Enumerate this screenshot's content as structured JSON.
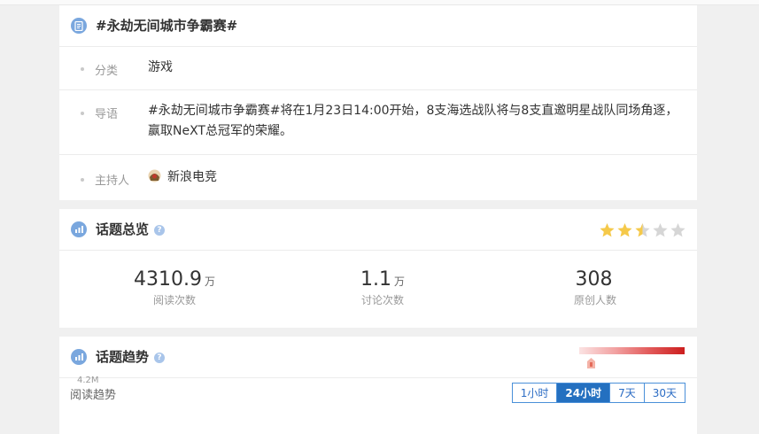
{
  "info": {
    "title": "#永劫无间城市争霸赛#",
    "category_label": "分类",
    "category_value": "游戏",
    "intro_label": "导语",
    "intro_value": "#永劫无间城市争霸赛#将在1月23日14:00开始，8支海选战队将与8支直邀明星战队同场角逐，赢取NeXT总冠军的荣耀。",
    "host_label": "主持人",
    "host_value": "新浪电竞"
  },
  "overview": {
    "title": "话题总览",
    "rating": 2.5,
    "rating_max": 5,
    "stats": [
      {
        "number": "4310.9",
        "unit": "万",
        "caption": "阅读次数"
      },
      {
        "number": "1.1",
        "unit": "万",
        "caption": "讨论次数"
      },
      {
        "number": "308",
        "unit": "",
        "caption": "原创人数"
      }
    ]
  },
  "trend": {
    "title": "话题趋势",
    "sub_label": "阅读趋势",
    "tabs": [
      "1小时",
      "24小时",
      "7天",
      "30天"
    ],
    "active_tab": "24小时",
    "y_top_label": "4.2M",
    "heat_level": 0.1
  },
  "colors": {
    "accent": "#2470c0",
    "star_on": "#f5c94a",
    "star_off": "#d6d6d6",
    "heat_high": "#cc1e1e"
  }
}
